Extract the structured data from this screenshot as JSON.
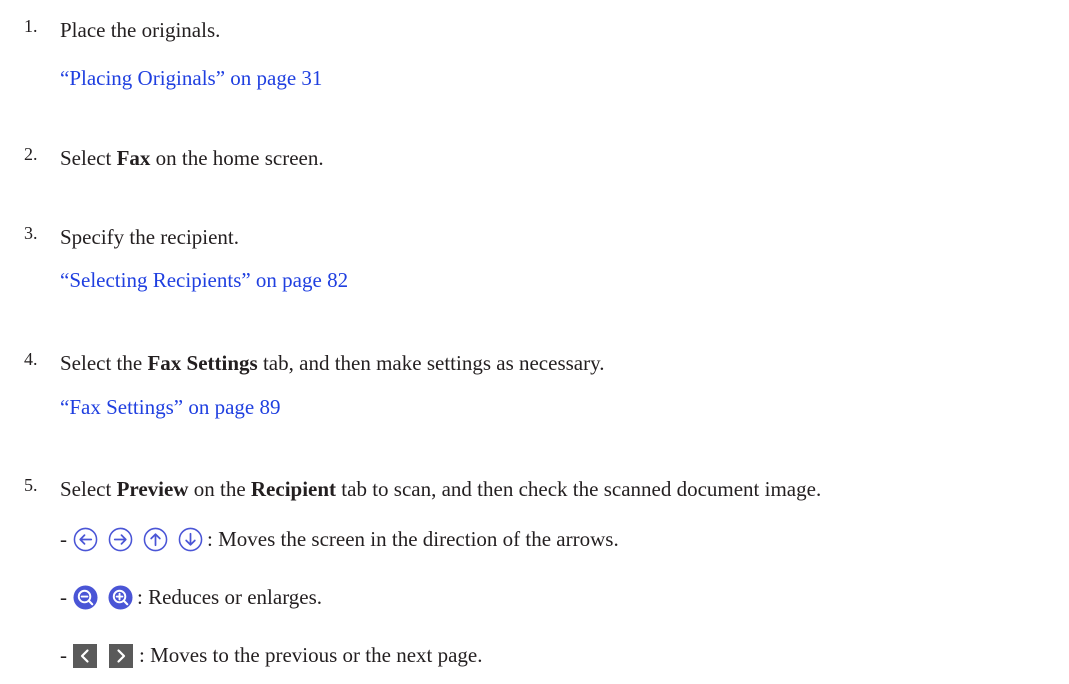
{
  "steps": [
    {
      "number": "1.",
      "text_parts": [
        "Place the originals."
      ],
      "link": "“Placing Originals” on page 31"
    },
    {
      "number": "2.",
      "pre": "Select ",
      "bold": "Fax",
      "post": " on the home screen."
    },
    {
      "number": "3.",
      "text": "Specify the recipient.",
      "link": "“Selecting Recipients” on page 82"
    },
    {
      "number": "4.",
      "pre": "Select the ",
      "bold": "Fax Settings",
      "post": " tab, and then make settings as necessary.",
      "link": "“Fax Settings” on page 89"
    },
    {
      "number": "5.",
      "pre": "Select ",
      "bold1": "Preview",
      "mid": " on the ",
      "bold2": "Recipient",
      "post": " tab to scan, and then check the scanned document image."
    }
  ],
  "bullets": [
    {
      "dash": "-",
      "icons": [
        "arrow-left-circle-icon",
        "arrow-right-circle-icon",
        "arrow-up-circle-icon",
        "arrow-down-circle-icon"
      ],
      "text": ": Moves the screen in the direction of the arrows."
    },
    {
      "dash": "-",
      "icons": [
        "zoom-out-icon",
        "zoom-in-icon"
      ],
      "text": ": Reduces or enlarges."
    },
    {
      "dash": "-",
      "icons": [
        "previous-page-icon",
        "next-page-icon"
      ],
      "text": ": Moves to the previous or the next page."
    }
  ],
  "colors": {
    "text": "#231f20",
    "link": "#1f3fe0",
    "icon_blue": "#4a55d6",
    "icon_gray": "#5a5a5a"
  }
}
